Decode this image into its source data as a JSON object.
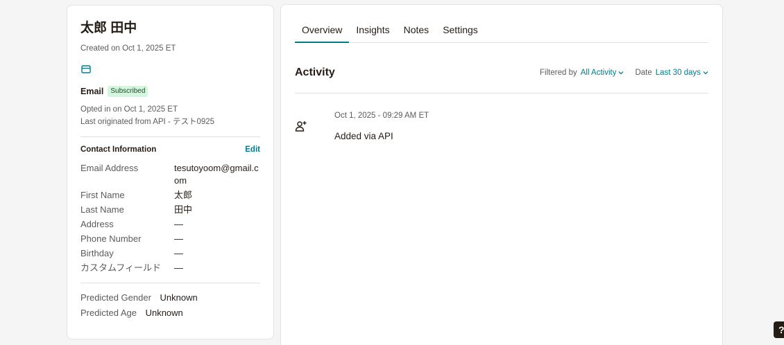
{
  "contact": {
    "name": "太郎 田中",
    "created": "Created on Oct 1, 2025 ET",
    "email_label": "Email",
    "email_status": "Subscribed",
    "opted_in": "Opted in on Oct 1, 2025 ET",
    "last_originated": "Last originated from API - テスト0925"
  },
  "contact_info": {
    "title": "Contact Information",
    "edit_label": "Edit",
    "fields": [
      {
        "label": "Email Address",
        "value": "tesutoyoom@gmail.com"
      },
      {
        "label": "First Name",
        "value": "太郎"
      },
      {
        "label": "Last Name",
        "value": "田中"
      },
      {
        "label": "Address",
        "value": "—"
      },
      {
        "label": "Phone Number",
        "value": "—"
      },
      {
        "label": "Birthday",
        "value": "—"
      },
      {
        "label": "カスタムフィールド",
        "value": "—"
      }
    ]
  },
  "predicted": {
    "gender_label": "Predicted Gender",
    "gender_value": "Unknown",
    "age_label": "Predicted Age",
    "age_value": "Unknown"
  },
  "tabs": [
    {
      "label": "Overview",
      "active": true
    },
    {
      "label": "Insights",
      "active": false
    },
    {
      "label": "Notes",
      "active": false
    },
    {
      "label": "Settings",
      "active": false
    }
  ],
  "activity": {
    "title": "Activity",
    "filter_label": "Filtered by",
    "filter_value": "All Activity",
    "date_label": "Date",
    "date_value": "Last 30 days",
    "events": [
      {
        "time": "Oct 1, 2025 - 09:29 AM ET",
        "description": "Added via API",
        "icon": "add-user-icon"
      }
    ]
  },
  "help_button": "?",
  "colors": {
    "accent": "#007c89",
    "badge_bg": "#d5f5dd",
    "text": "#241c15"
  }
}
